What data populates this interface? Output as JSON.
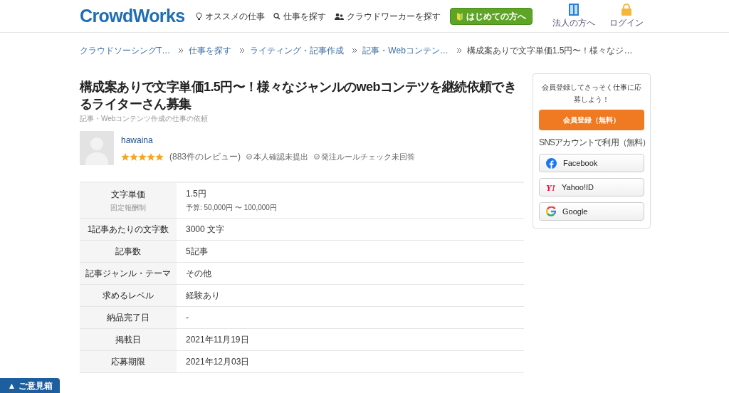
{
  "header": {
    "logo": "CrowdWorks",
    "nav": [
      {
        "kind": "bulb",
        "label": "オススメの仕事"
      },
      {
        "kind": "search",
        "label": "仕事を探す"
      },
      {
        "kind": "people",
        "label": "クラウドワーカーを探す"
      }
    ],
    "start_button": "はじめての方へ",
    "links": [
      {
        "kind": "building",
        "label": "法人の方へ"
      },
      {
        "kind": "lock",
        "label": "ログイン"
      }
    ]
  },
  "breadcrumb": [
    {
      "label": "クラウドソーシングT…",
      "current": false
    },
    {
      "label": "仕事を探す",
      "current": false
    },
    {
      "label": "ライティング・記事作成",
      "current": false
    },
    {
      "label": "記事・Webコンテン…",
      "current": false
    },
    {
      "label": "構成案ありで文字単価1.5円〜！様々なジ…",
      "current": true
    }
  ],
  "job": {
    "title": "構成案ありで文字単価1.5円〜！様々なジャンルのwebコンテツを継続依頼できるライターさん募集",
    "category": "記事・Webコンテンツ作成の仕事の依頼"
  },
  "client": {
    "name": "hawaina",
    "stars": 5,
    "reviews": "(883件のレビュー)",
    "badges": [
      "本人確認未提出",
      "発注ルールチェック未回答"
    ]
  },
  "details": [
    {
      "label": "文字単価",
      "sublabel": "固定報酬制",
      "value": "1.5円",
      "subvalue": "予算: 50,000円 〜 100,000円"
    },
    {
      "label": "1記事あたりの文字数",
      "value": "3000 文字"
    },
    {
      "label": "記事数",
      "value": "5記事"
    },
    {
      "label": "記事ジャンル・テーマ",
      "value": "その他"
    },
    {
      "label": "求めるレベル",
      "value": "経験あり"
    },
    {
      "label": "納品完了日",
      "value": "-"
    },
    {
      "label": "掲載日",
      "value": "2021年11月19日"
    },
    {
      "label": "応募期限",
      "value": "2021年12月03日"
    }
  ],
  "signup": {
    "message": "会員登録してさっそく仕事に応募しよう！",
    "button": "会員登録（無料）",
    "sns_label": "SNSアカウントで利用（無料）",
    "sns": [
      {
        "kind": "facebook",
        "label": "Facebook"
      },
      {
        "kind": "yahoo",
        "logo": "Y!",
        "label": "Yahoo!ID"
      },
      {
        "kind": "google",
        "label": "Google"
      }
    ]
  },
  "feedback": "▲ ご意見箱"
}
